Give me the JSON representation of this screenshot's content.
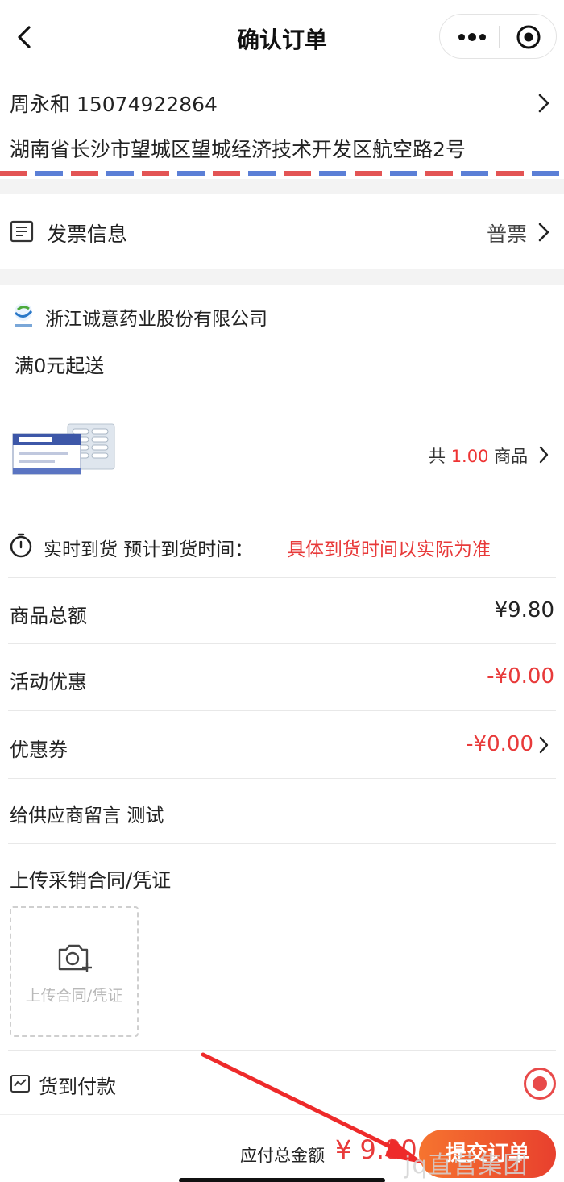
{
  "nav": {
    "title": "确认订单"
  },
  "address": {
    "name_phone": "周永和 15074922864",
    "detail": "湖南省长沙市望城区望城经济技术开发区航空路2号"
  },
  "invoice": {
    "label": "发票信息",
    "value": "普票"
  },
  "supplier": {
    "name": "浙江诚意药业股份有限公司",
    "min_order": "满0元起送",
    "count_prefix": "共",
    "count_value": "1.00",
    "count_suffix": "商品"
  },
  "delivery": {
    "label": "实时到货  预计到货时间：",
    "note": "具体到货时间以实际为准"
  },
  "summary": {
    "goods_total_label": "商品总额",
    "goods_total_value": "¥9.80",
    "promotion_label": "活动优惠",
    "promotion_value": "-¥0.00",
    "coupon_label": "优惠券",
    "coupon_value": "-¥0.00",
    "message_label": "给供应商留言",
    "message_value": "测试"
  },
  "upload": {
    "label": "上传采销合同/凭证",
    "button_text": "上传合同/凭证"
  },
  "payment": {
    "label": "货到付款",
    "selected": true
  },
  "footer": {
    "total_label": "应付总金额",
    "total_value": "¥ 9.80",
    "submit_label": "提交订单"
  },
  "watermark": "jq直营集团",
  "colors": {
    "accent_red": "#e83a3a",
    "button_start": "#f6742f",
    "button_end": "#e8402e"
  },
  "icons": [
    "back-icon",
    "more-icon",
    "target-icon",
    "chevron-right-icon",
    "invoice-icon",
    "stopwatch-icon",
    "camera-add-icon",
    "payment-icon",
    "radio-checked-icon"
  ]
}
